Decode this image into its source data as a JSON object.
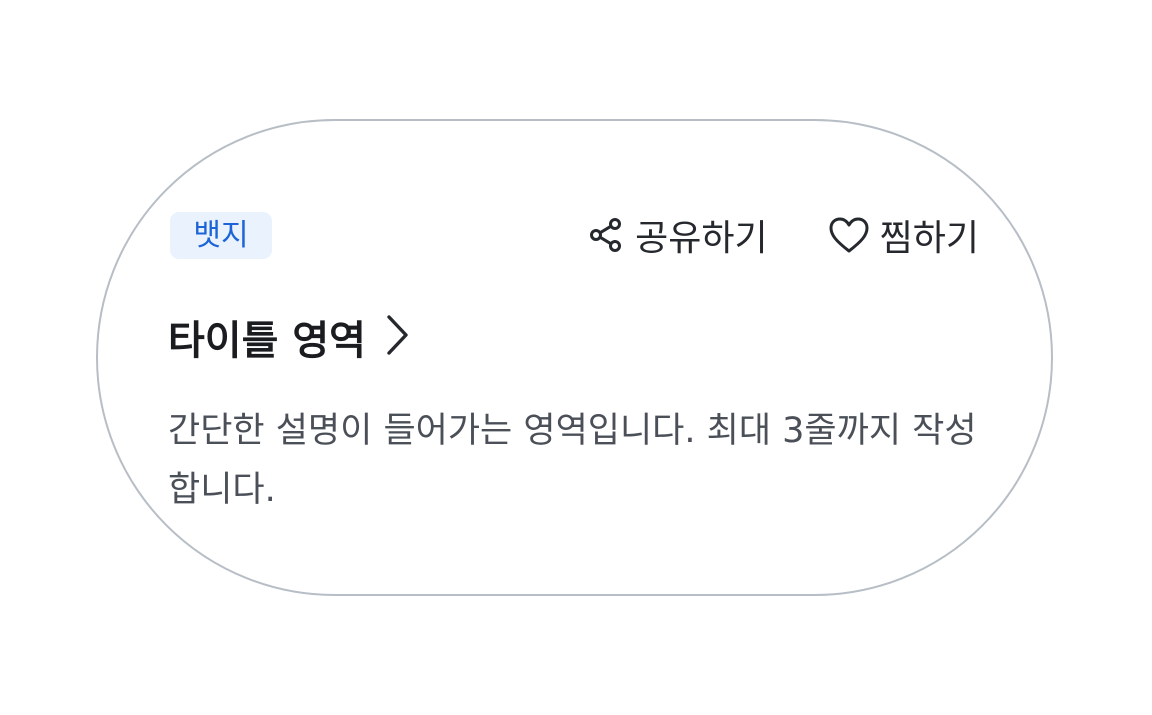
{
  "card": {
    "badge": "뱃지",
    "actions": {
      "share_label": "공유하기",
      "favorite_label": "찜하기"
    },
    "title": "타이틀 영역",
    "description": "간단한 설명이 들어가는 영역입니다. 최대 3줄까지 작성합니다.",
    "icons": [
      "share-icon",
      "heart-icon",
      "chevron-right-icon"
    ]
  },
  "colors": {
    "badge_background": "#eaf2fe",
    "badge_text": "#1d64d8",
    "card_border": "#b7bec6",
    "title_text": "#1a1c20",
    "description_text": "#4b5058"
  }
}
